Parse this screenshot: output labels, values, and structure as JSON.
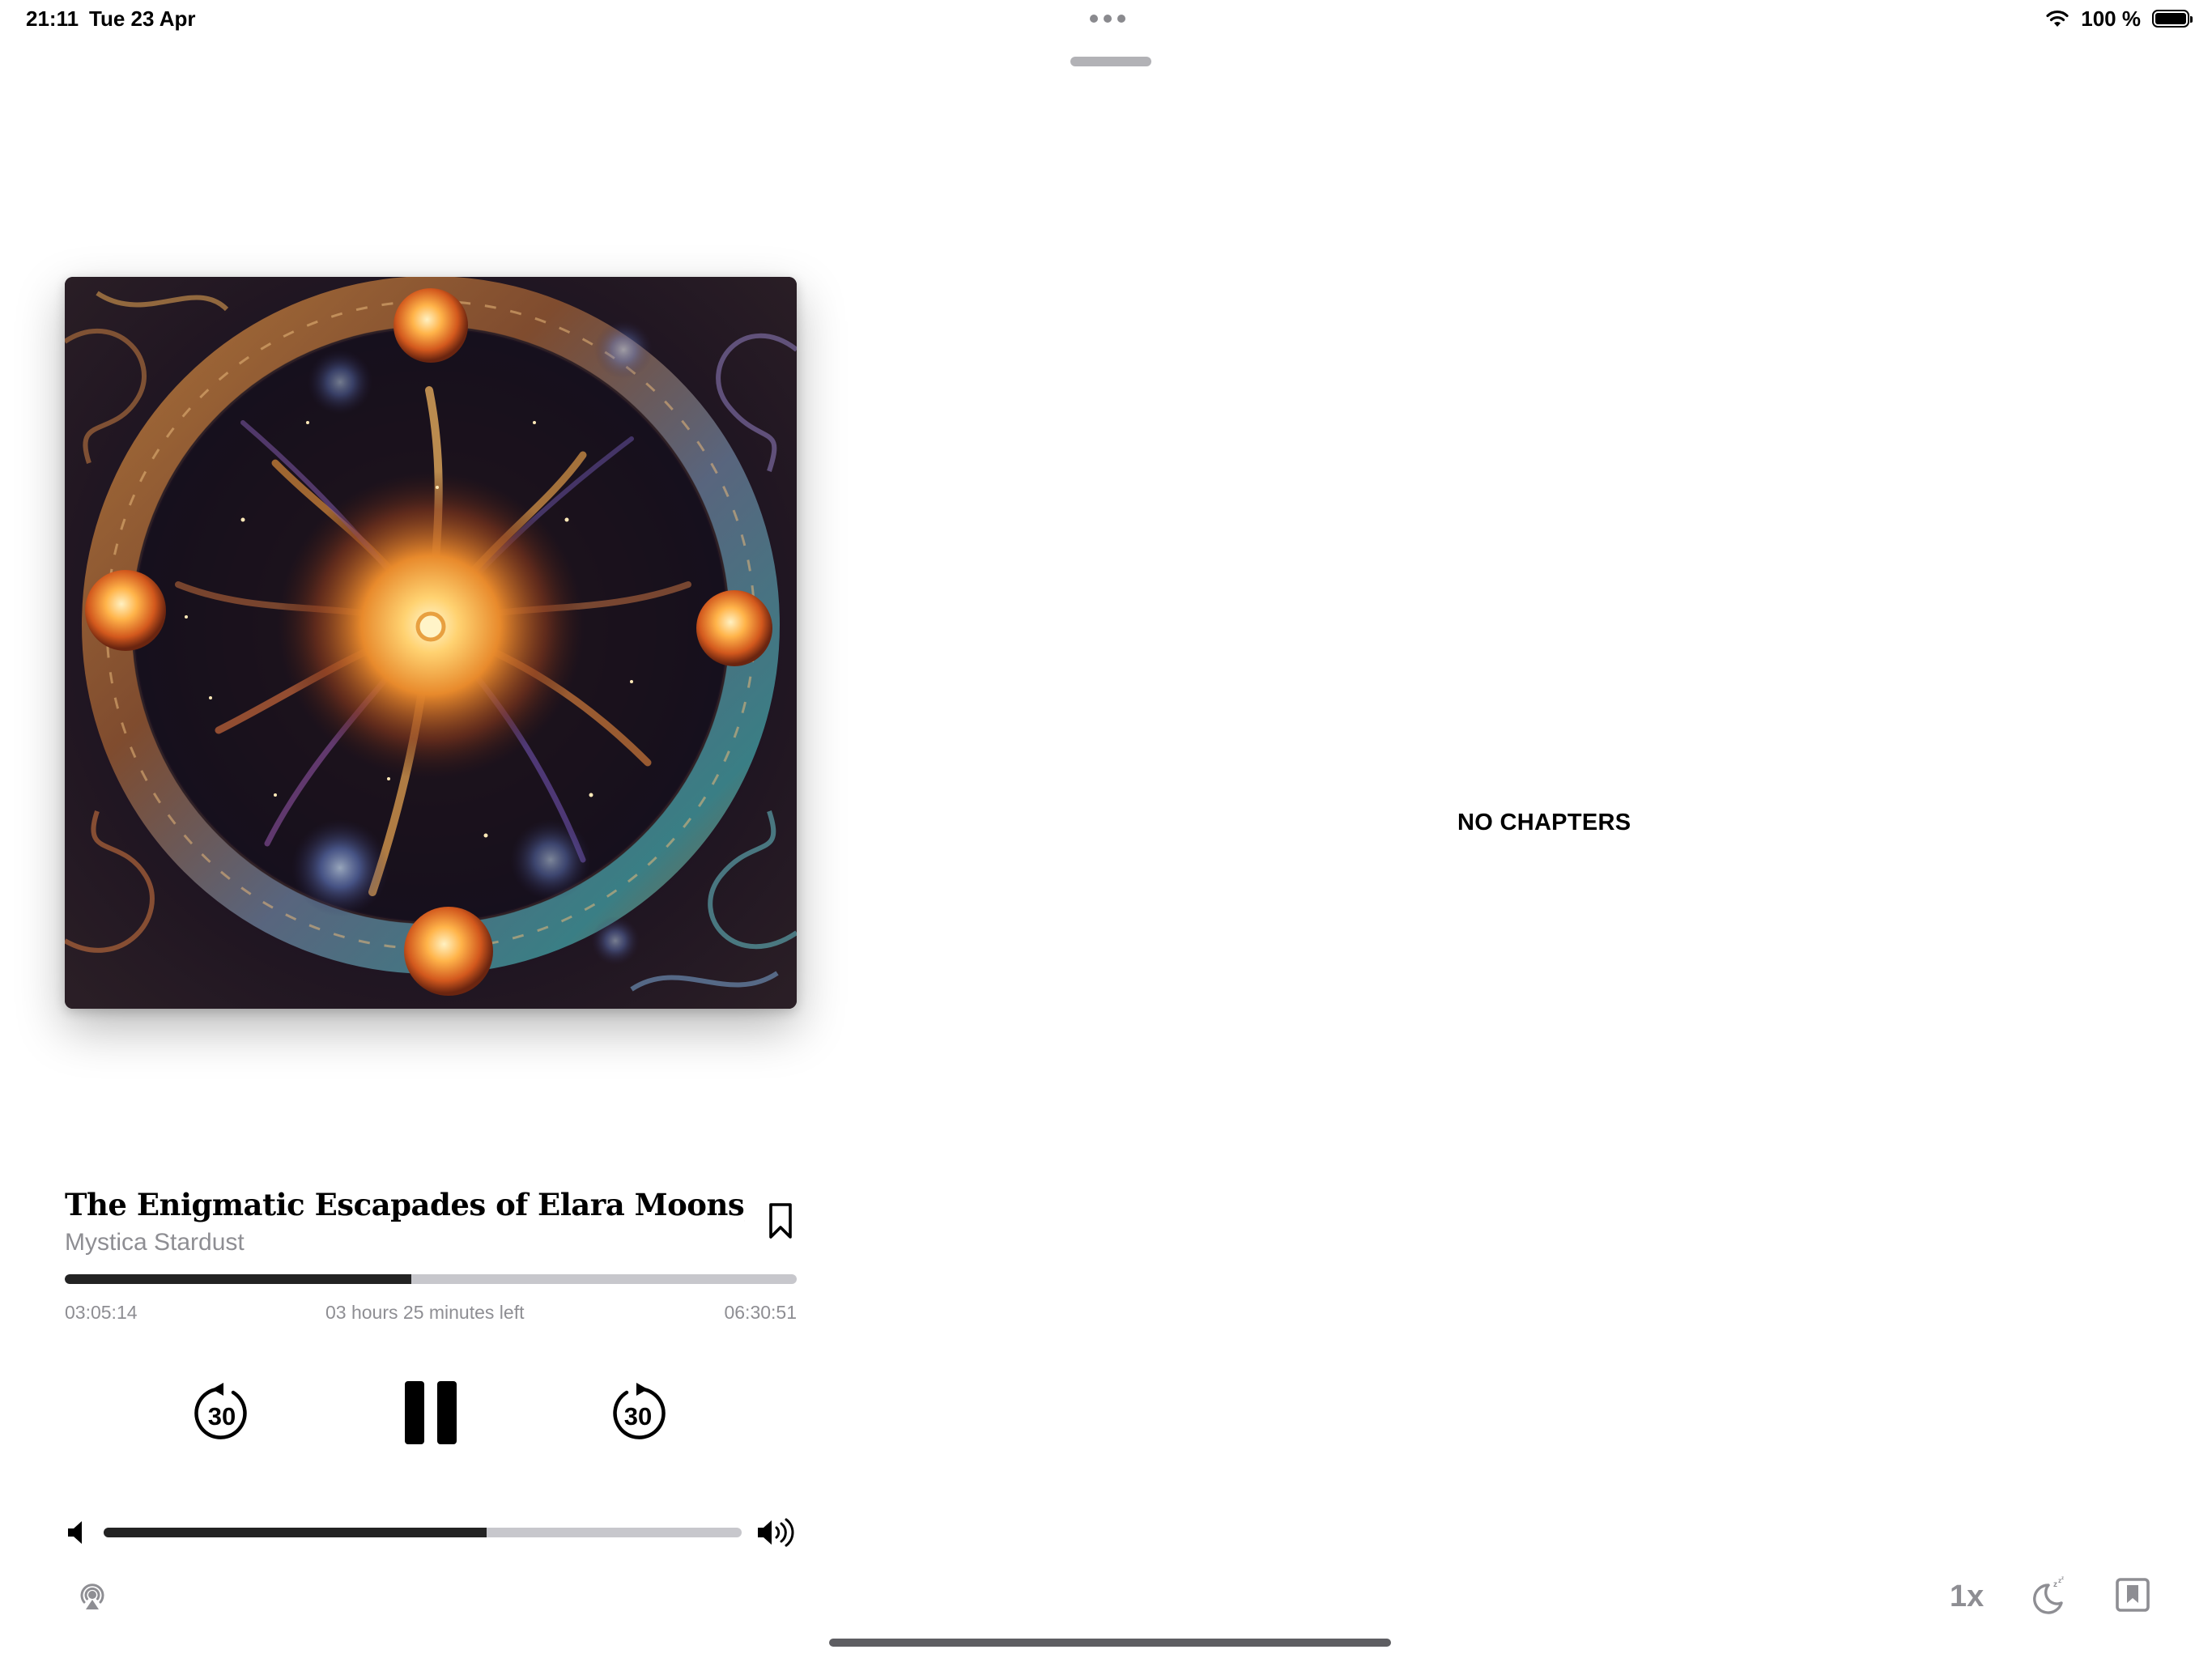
{
  "status_bar": {
    "time": "21:11",
    "date": "Tue 23 Apr",
    "battery_text": "100 %",
    "wifi_icon": "wifi-icon",
    "battery_icon": "battery-full-icon"
  },
  "artwork": {
    "icon": "cosmic-mandala-cover-art"
  },
  "track": {
    "title": "The Enigmatic Escapades of Elara Moonspinner'...",
    "author": "Mystica Stardust"
  },
  "progress": {
    "elapsed": "03:05:14",
    "remaining_text": "03 hours 25 minutes left",
    "total": "06:30:51",
    "fraction": 0.474
  },
  "controls": {
    "skip_back_seconds": "30",
    "skip_forward_seconds": "30",
    "state": "playing"
  },
  "volume": {
    "fraction": 0.6
  },
  "toolbar": {
    "speed_label": "1x"
  },
  "chapters": {
    "empty_label": "NO CHAPTERS"
  },
  "colors": {
    "accent_fill": "#232323",
    "track_bg": "#c7c7cc",
    "secondary_text": "#8e8e93"
  }
}
